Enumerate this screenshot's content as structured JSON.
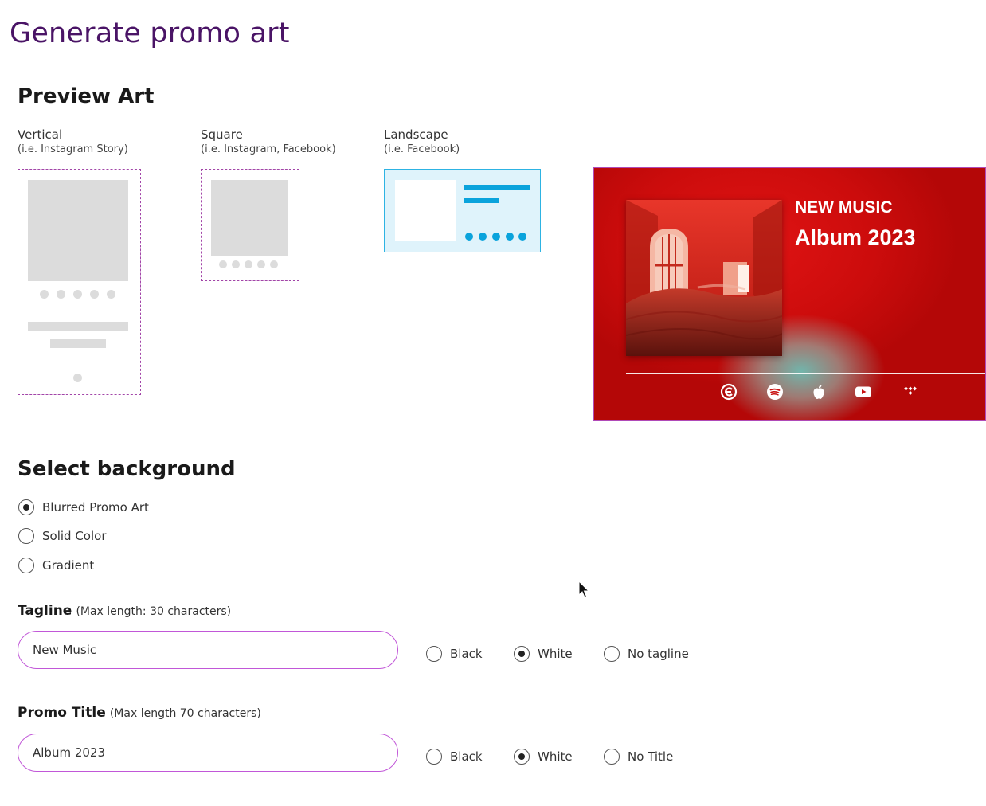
{
  "page": {
    "title": "Generate promo art"
  },
  "preview": {
    "heading": "Preview Art",
    "formats": [
      {
        "label": "Vertical",
        "sublabel": "(i.e. Instagram Story)"
      },
      {
        "label": "Square",
        "sublabel": "(i.e. Instagram, Facebook)"
      },
      {
        "label": "Landscape",
        "sublabel": "(i.e. Facebook)"
      }
    ],
    "selected_format": "Landscape",
    "art": {
      "tagline": "NEW MUSIC",
      "title": "Album 2023",
      "service_icons": [
        "gaana-icon",
        "spotify-icon",
        "apple-icon",
        "youtube-icon",
        "tidal-icon"
      ]
    }
  },
  "background": {
    "heading": "Select background",
    "options": [
      "Blurred Promo Art",
      "Solid Color",
      "Gradient"
    ],
    "selected": "Blurred Promo Art"
  },
  "tagline": {
    "label": "Tagline",
    "hint": "(Max length: 30 characters)",
    "value": "New Music",
    "color_options": [
      "Black",
      "White",
      "No tagline"
    ],
    "selected_color": "White"
  },
  "promo_title": {
    "label": "Promo Title",
    "hint": "(Max length 70 characters)",
    "value": "Album 2023",
    "color_options": [
      "Black",
      "White",
      "No Title"
    ],
    "selected_color": "White"
  },
  "colors": {
    "title_purple": "#4a1466",
    "accent_magenta": "#c157d8",
    "preview_red": "#cc0c0c",
    "landscape_blue": "#0aa3dc"
  }
}
